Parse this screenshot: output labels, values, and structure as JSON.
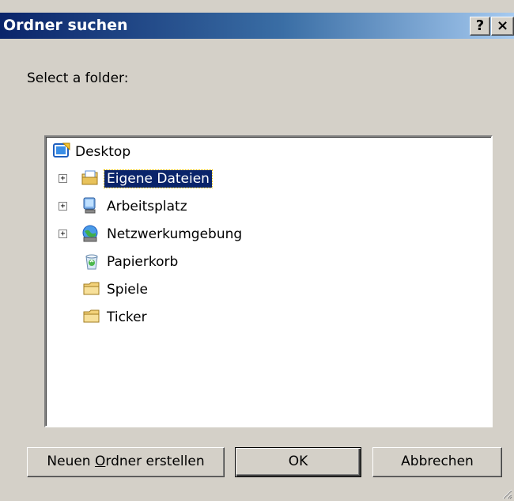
{
  "window": {
    "title": "Ordner suchen",
    "help_label": "?",
    "close_label": "×"
  },
  "prompt": "Select a folder:",
  "tree": {
    "root": {
      "label": "Desktop",
      "icon": "desktop-icon"
    },
    "items": [
      {
        "label": "Eigene Dateien",
        "icon": "my-documents-icon",
        "expander": "+",
        "selected": true
      },
      {
        "label": "Arbeitsplatz",
        "icon": "my-computer-icon",
        "expander": "+"
      },
      {
        "label": "Netzwerkumgebung",
        "icon": "network-places-icon",
        "expander": "+"
      },
      {
        "label": "Papierkorb",
        "icon": "recycle-bin-icon"
      },
      {
        "label": "Spiele",
        "icon": "folder-icon"
      },
      {
        "label": "Ticker",
        "icon": "folder-icon"
      }
    ]
  },
  "buttons": {
    "new_folder_prefix": "Neuen ",
    "new_folder_mnemonic": "O",
    "new_folder_suffix": "rdner erstellen",
    "ok": "OK",
    "cancel": "Abbrechen"
  },
  "colors": {
    "face": "#d4d0c8",
    "title_active": "#0a246a",
    "selection": "#0a246a"
  }
}
